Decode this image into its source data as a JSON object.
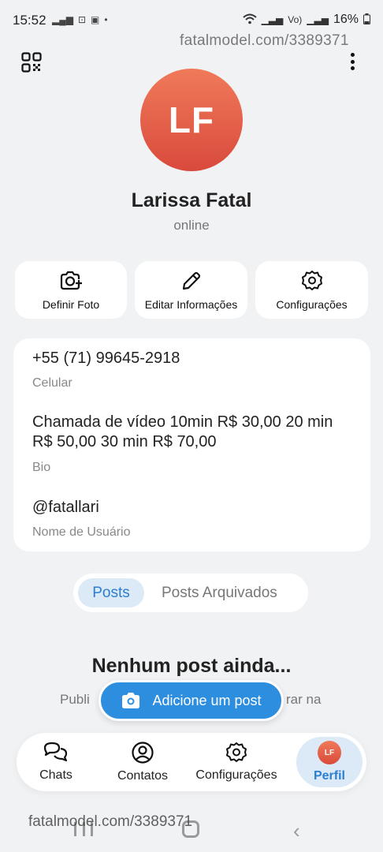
{
  "status_bar": {
    "time": "15:52",
    "battery": "16%"
  },
  "watermark": {
    "top": "fatalmodel.com/3389371",
    "bottom": "fatalmodel.com/3389371"
  },
  "profile": {
    "initials": "LF",
    "name": "Larissa Fatal",
    "status": "online",
    "avatar_gradient": [
      "#f07a5a",
      "#d94a3c"
    ]
  },
  "actions": [
    {
      "label": "Definir Foto",
      "icon": "camera-plus-icon"
    },
    {
      "label": "Editar Informações",
      "icon": "pencil-icon"
    },
    {
      "label": "Configurações",
      "icon": "gear-icon"
    }
  ],
  "info": {
    "phone": "+55 (71) 99645-2918",
    "phone_label": "Celular",
    "bio": "Chamada de vídeo 10min R$ 30,00 20 min R$ 50,00 30 min R$ 70,00",
    "bio_label": "Bio",
    "username": "@fatallari",
    "username_label": "Nome de Usuário"
  },
  "tabs": [
    {
      "label": "Posts",
      "active": true
    },
    {
      "label": "Posts Arquivados",
      "active": false
    }
  ],
  "empty_state": {
    "title": "Nenhum post ainda...",
    "desc_left": "Publi",
    "desc_right": "rar na"
  },
  "add_post": {
    "label": "Adicione um post",
    "color": "#2d8ee0"
  },
  "bottom_nav": [
    {
      "label": "Chats",
      "icon": "chat-bubbles-icon"
    },
    {
      "label": "Contatos",
      "icon": "user-circle-icon"
    },
    {
      "label": "Configurações",
      "icon": "gear-icon"
    },
    {
      "label": "Perfil",
      "icon": "avatar",
      "active": true
    }
  ],
  "accent_color": "#2a7fd1"
}
